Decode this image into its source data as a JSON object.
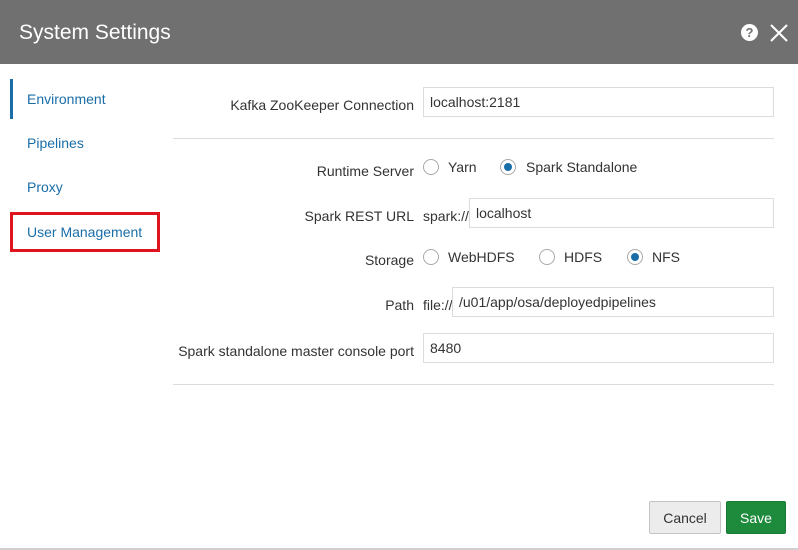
{
  "dialog": {
    "title": "System Settings"
  },
  "sidebar": {
    "items": [
      {
        "label": "Environment",
        "active": true
      },
      {
        "label": "Pipelines"
      },
      {
        "label": "Proxy"
      },
      {
        "label": "User Management",
        "highlighted": true
      }
    ]
  },
  "form": {
    "kafka": {
      "label": "Kafka ZooKeeper Connection",
      "value": "localhost:2181"
    },
    "runtime_server": {
      "label": "Runtime Server",
      "options": [
        "Yarn",
        "Spark Standalone"
      ],
      "selected": "Spark Standalone"
    },
    "spark_rest_url": {
      "label": "Spark REST URL",
      "prefix": "spark://",
      "value": "localhost"
    },
    "storage": {
      "label": "Storage",
      "options": [
        "WebHDFS",
        "HDFS",
        "NFS"
      ],
      "selected": "NFS"
    },
    "path": {
      "label": "Path",
      "prefix": "file://",
      "value": "/u01/app/osa/deployedpipelines"
    },
    "master_port": {
      "label": "Spark standalone master console port",
      "value": "8480"
    }
  },
  "footer": {
    "cancel_label": "Cancel",
    "save_label": "Save"
  },
  "colors": {
    "header_bg": "#707070",
    "link": "#1a6ea8",
    "highlight_border": "#e0141e",
    "save_bg": "#1e8a3c"
  },
  "icons": {
    "help": "help-icon",
    "close": "close-icon"
  }
}
